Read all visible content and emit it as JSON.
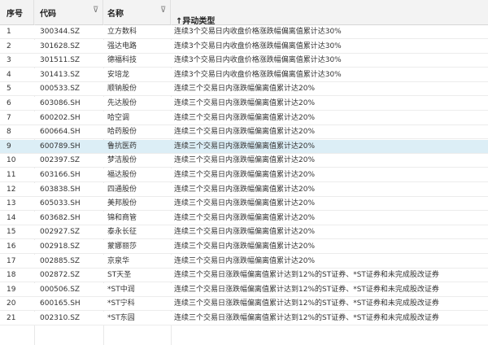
{
  "header": {
    "col_no": "序号",
    "col_code": "代码",
    "col_name": "名称",
    "col_type": "↑异动类型",
    "filter_glyph": "⊽"
  },
  "rows": [
    {
      "no": "1",
      "code": "300344.SZ",
      "name": "立方数科",
      "type": "连续3个交易日内收盘价格涨跌幅偏离值累计达30%"
    },
    {
      "no": "2",
      "code": "301628.SZ",
      "name": "强达电路",
      "type": "连续3个交易日内收盘价格涨跌幅偏离值累计达30%"
    },
    {
      "no": "3",
      "code": "301511.SZ",
      "name": "德福科技",
      "type": "连续3个交易日内收盘价格涨跌幅偏离值累计达30%"
    },
    {
      "no": "4",
      "code": "301413.SZ",
      "name": "安培龙",
      "type": "连续3个交易日内收盘价格涨跌幅偏离值累计达30%"
    },
    {
      "no": "5",
      "code": "000533.SZ",
      "name": "顺钠股份",
      "type": "连续三个交易日内涨跌幅偏离值累计达20%"
    },
    {
      "no": "6",
      "code": "603086.SH",
      "name": "先达股份",
      "type": "连续三个交易日内涨跌幅偏离值累计达20%"
    },
    {
      "no": "7",
      "code": "600202.SH",
      "name": "哈空调",
      "type": "连续三个交易日内涨跌幅偏离值累计达20%"
    },
    {
      "no": "8",
      "code": "600664.SH",
      "name": "哈药股份",
      "type": "连续三个交易日内涨跌幅偏离值累计达20%"
    },
    {
      "no": "9",
      "code": "600789.SH",
      "name": "鲁抗医药",
      "type": "连续三个交易日内涨跌幅偏离值累计达20%"
    },
    {
      "no": "10",
      "code": "002397.SZ",
      "name": "梦洁股份",
      "type": "连续三个交易日内涨跌幅偏离值累计达20%"
    },
    {
      "no": "11",
      "code": "603166.SH",
      "name": "福达股份",
      "type": "连续三个交易日内涨跌幅偏离值累计达20%"
    },
    {
      "no": "12",
      "code": "603838.SH",
      "name": "四通股份",
      "type": "连续三个交易日内涨跌幅偏离值累计达20%"
    },
    {
      "no": "13",
      "code": "605033.SH",
      "name": "美邦股份",
      "type": "连续三个交易日内涨跌幅偏离值累计达20%"
    },
    {
      "no": "14",
      "code": "603682.SH",
      "name": "锦和商管",
      "type": "连续三个交易日内涨跌幅偏离值累计达20%"
    },
    {
      "no": "15",
      "code": "002927.SZ",
      "name": "泰永长征",
      "type": "连续三个交易日内涨跌幅偏离值累计达20%"
    },
    {
      "no": "16",
      "code": "002918.SZ",
      "name": "蒙娜丽莎",
      "type": "连续三个交易日内涨跌幅偏离值累计达20%"
    },
    {
      "no": "17",
      "code": "002885.SZ",
      "name": "京泉华",
      "type": "连续三个交易日内涨跌幅偏离值累计达20%"
    },
    {
      "no": "18",
      "code": "002872.SZ",
      "name": "ST天圣",
      "type": "连续三个交易日涨跌幅偏离值累计达到12%的ST证券、*ST证券和未完成股改证券"
    },
    {
      "no": "19",
      "code": "000506.SZ",
      "name": "*ST中润",
      "type": "连续三个交易日涨跌幅偏离值累计达到12%的ST证券、*ST证券和未完成股改证券"
    },
    {
      "no": "20",
      "code": "600165.SH",
      "name": "*ST宁科",
      "type": "连续三个交易日涨跌幅偏离值累计达到12%的ST证券、*ST证券和未完成股改证券"
    },
    {
      "no": "21",
      "code": "002310.SZ",
      "name": "*ST东园",
      "type": "连续三个交易日涨跌幅偏离值累计达到12%的ST证券、*ST证券和未完成股改证券"
    }
  ]
}
